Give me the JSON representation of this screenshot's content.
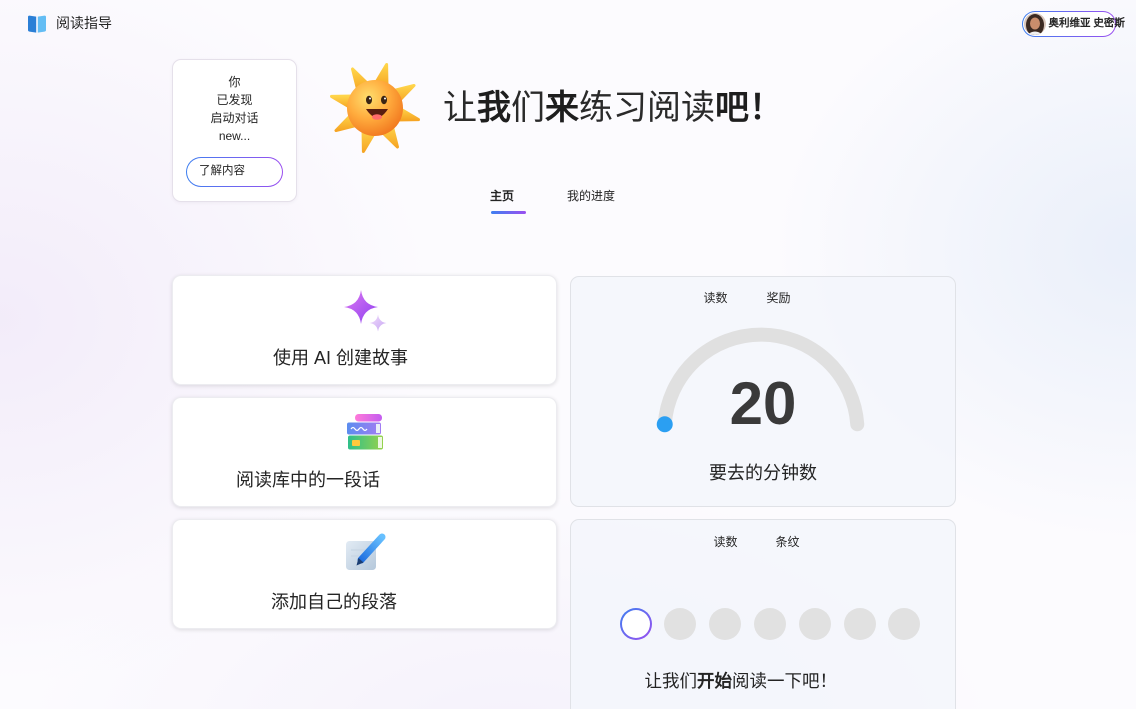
{
  "app": {
    "title": "阅读指导",
    "logo_icon": "book-icon"
  },
  "user": {
    "name": "奥利维亚 史密斯",
    "avatar_icon": "avatar"
  },
  "discovery_card": {
    "lines": [
      "你",
      "已发现",
      "启动对话",
      "new..."
    ],
    "button_label": "了解内容"
  },
  "hero": {
    "mascot_icon": "sun-mascot-icon",
    "heading_parts": [
      "让",
      "我",
      "们",
      "来",
      "练习阅读",
      "吧！"
    ]
  },
  "nav": {
    "tabs": [
      "主页",
      "我的进度"
    ],
    "active_index": 0
  },
  "activities": [
    {
      "label": "使用 AI 创建故事",
      "icon": "sparkle-icon"
    },
    {
      "label": "阅读库中的一段话",
      "icon": "books-icon"
    },
    {
      "label": "添加自己的段落",
      "icon": "notepad-pen-icon"
    }
  ],
  "goal_card": {
    "tabs": [
      "读数",
      "奖励"
    ],
    "value": "20",
    "caption": "要去的分钟数",
    "progress": 0
  },
  "streak_card": {
    "tabs": [
      "读数",
      "条纹"
    ],
    "days_total": 7,
    "days_completed": 0,
    "current_index": 0,
    "message_parts": [
      "让我们",
      "开始",
      "阅读一下吧！"
    ]
  },
  "colors": {
    "text": "#242424",
    "accent_blue": "#3d7ff0",
    "accent_purple": "#9b4ff0",
    "gauge_track": "#e0e0e0",
    "gauge_indicator": "#2b9ff2",
    "streak_empty": "#e1e1e1"
  }
}
